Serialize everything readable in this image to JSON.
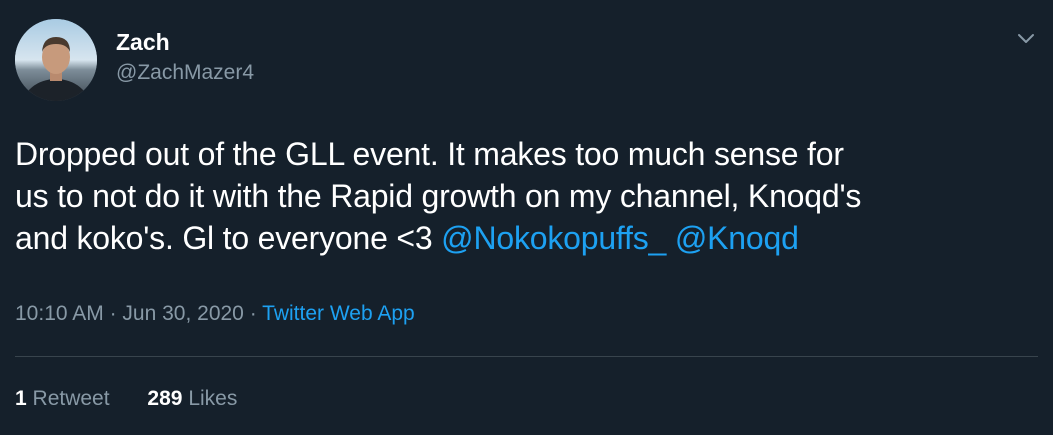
{
  "tweet": {
    "author": {
      "display_name": "Zach",
      "handle": "@ZachMazer4"
    },
    "text_plain": "Dropped out of the GLL event. It makes too much sense for\nus to not do it with the Rapid growth on my channel, Knoqd's\nand koko's. Gl to everyone <3 ",
    "mentions": [
      "@Nokokopuffs_",
      "@Knoqd"
    ],
    "time": "10:10 AM",
    "date": "Jun 30, 2020",
    "source": "Twitter Web App",
    "separator": "·",
    "stats": {
      "retweets_count": "1",
      "retweets_label": "Retweet",
      "likes_count": "289",
      "likes_label": "Likes"
    }
  },
  "colors": {
    "background": "#15202b",
    "text": "#ffffff",
    "secondary": "#8899a6",
    "accent": "#1da1f2",
    "divider": "#38444d"
  },
  "icons": {
    "menu": "chevron-down-icon"
  }
}
